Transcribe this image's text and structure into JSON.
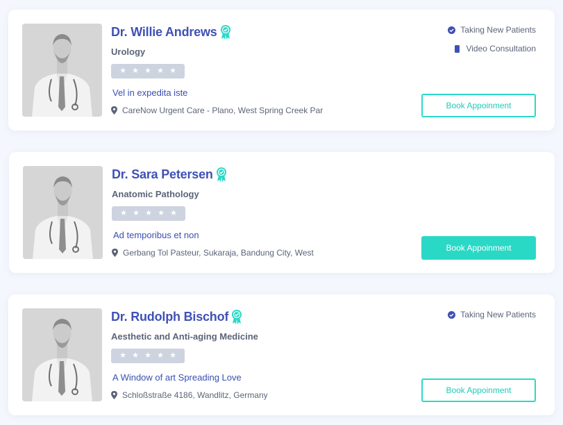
{
  "colors": {
    "accent_teal": "#2ad8c6",
    "name_blue": "#3f51b5",
    "star_bg": "#cdd3df"
  },
  "doctors": [
    {
      "name": "Dr. Willie Andrews",
      "specialty": "Urology",
      "rating": 0,
      "max_rating": 5,
      "tagline": "Vel in expedita iste",
      "address": "CareNow Urgent Care - Plano, West Spring Creek Par",
      "features": [
        "Taking New Patients",
        "Video Consultation"
      ],
      "book_label": "Book Appoinment",
      "book_style": "outline"
    },
    {
      "name": "Dr. Sara Petersen",
      "specialty": "Anatomic Pathology",
      "rating": 0,
      "max_rating": 5,
      "tagline": "Ad temporibus et non",
      "address": "Gerbang Tol Pasteur, Sukaraja, Bandung City, West",
      "features": [],
      "book_label": "Book Appoinment",
      "book_style": "filled"
    },
    {
      "name": "Dr. Rudolph Bischof",
      "specialty": "Aesthetic and Anti-aging Medicine",
      "rating": 0,
      "max_rating": 5,
      "tagline": "A Window of art Spreading Love",
      "address": "Schloßstraße 4186, Wandlitz, Germany",
      "features": [
        "Taking New Patients"
      ],
      "book_label": "Book Appoinment",
      "book_style": "outline"
    }
  ]
}
